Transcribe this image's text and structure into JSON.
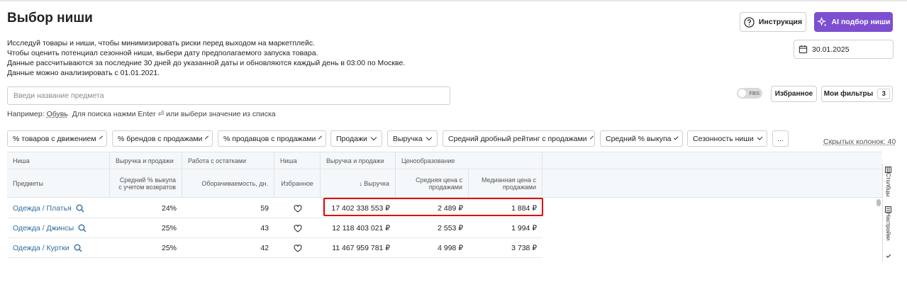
{
  "page": {
    "title": "Выбор ниши",
    "description": [
      "Исследуй товары и ниши, чтобы минимизировать риски перед выходом на маркетплейс.",
      "Чтобы оценить потенциал сезонной ниши, выбери дату предполагаемого запуска товара.",
      "Данные рассчитываются за последние 30 дней до указанной даты и обновляются каждый день в 03:00 по Москве.",
      "Данные можно анализировать с 01.01.2021."
    ]
  },
  "header": {
    "instruction_label": "Инструкция",
    "ai_label": "AI подбор ниши",
    "date_value": "30.01.2025"
  },
  "search": {
    "placeholder": "Введи название предмета",
    "hint_prefix": "Например:",
    "hint_example": "Обувь",
    "hint_suffix": "Для поиска нажми Enter ⏎ или выбери значение из списка"
  },
  "toolbar": {
    "fbs_label": "FBS",
    "favorites_label": "Избранное",
    "my_filters_label": "Мои фильтры",
    "my_filters_count": "3"
  },
  "filters": [
    "% товаров с движением",
    "% брендов с продажами",
    "% продавцов с продажами",
    "Продажи",
    "Выручка",
    "Средний дробный рейтинг с продажами",
    "Средний % выкупа",
    "Сезонность ниши"
  ],
  "more_label": "...",
  "hidden_columns": "Скрытых колонок: 40",
  "table": {
    "groups": [
      "Ниша",
      "Выручка и продажи",
      "Работа с остатками",
      "Ниша",
      "Выручка и продажи",
      "Ценообразование"
    ],
    "columns": [
      "Предметы",
      "Средний % выкупа с учетом возвратов",
      "Оборачиваемость, дн.",
      "Избранное",
      "↓ Выручка",
      "Средняя цена с продажами",
      "Медианная цена с продажами"
    ],
    "rows": [
      {
        "name": "Одежда / Платья",
        "buyout": "24%",
        "turnover": "59",
        "revenue": "17 402 338 553 ₽",
        "avg_price": "2 489 ₽",
        "median_price": "1 884 ₽"
      },
      {
        "name": "Одежда / Джинсы",
        "buyout": "25%",
        "turnover": "43",
        "revenue": "12 118 403 021 ₽",
        "avg_price": "2 553 ₽",
        "median_price": "1 994 ₽"
      },
      {
        "name": "Одежда / Куртки",
        "buyout": "25%",
        "turnover": "42",
        "revenue": "11 467 959 781 ₽",
        "avg_price": "4 998 ₽",
        "median_price": "3 738 ₽"
      }
    ]
  },
  "side_panel": {
    "columns_label": "Столбцы",
    "settings_label": "Настройки"
  },
  "colors": {
    "accent": "#7d4fd0",
    "link": "#2e6da4",
    "highlight": "#e00000",
    "header_bg": "#f4f8fb"
  }
}
